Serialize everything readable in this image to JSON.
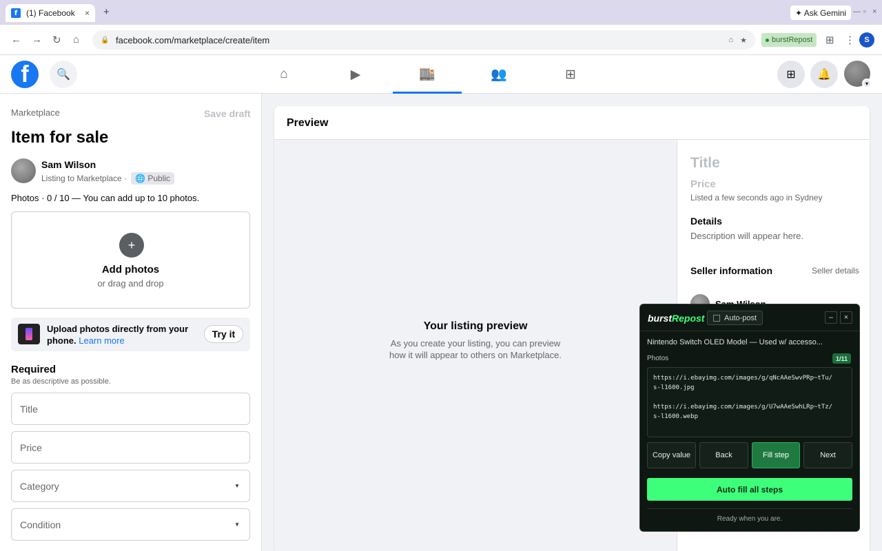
{
  "browser": {
    "tab_title": "(1) Facebook",
    "tab_favicon": "f",
    "tab_close": "×",
    "new_tab": "+",
    "ask_gemini": "✦ Ask Gemini",
    "url": "facebook.com/marketplace/create/item",
    "extension_label": "burstRepost",
    "profile_initial": "S"
  },
  "fb": {
    "logo": "f",
    "nav_active": "marketplace"
  },
  "sidebar": {
    "breadcrumb": "Marketplace",
    "save_draft": "Save draft",
    "title": "Item for sale",
    "seller_name": "Sam Wilson",
    "listing_to": "Listing to Marketplace ·",
    "privacy": "🌐 Public",
    "photos_label": "Photos · 0 / 10 — You can add up to 10 photos.",
    "add_photos": "Add photos",
    "add_photos_sub": "or drag and drop",
    "phone_upload_text": "Upload photos directly from your phone.",
    "learn_more": "Learn more",
    "try_it": "Try it",
    "required": "Required",
    "required_sub": "Be as descriptive as possible.",
    "fields": {
      "title": "Title",
      "price": "Price",
      "category": "Category",
      "condition": "Condition"
    }
  },
  "preview": {
    "header": "Preview",
    "stage_title": "Your listing preview",
    "stage_sub": "As you create your listing, you can preview how it will appear to others on Marketplace.",
    "title_placeholder": "Title",
    "price_placeholder": "Price",
    "listed": "Listed a few seconds ago in Sydney",
    "details": "Details",
    "description": "Description will appear here.",
    "seller_info": "Seller information",
    "seller_details": "Seller details",
    "seller_name": "Sam Wilson"
  },
  "burst": {
    "logo_a": "burst",
    "logo_b": "Repost",
    "auto_post": "Auto-post",
    "minimize": "–",
    "close": "×",
    "item_title": "Nintendo Switch OLED Model — Used w/ accesso...",
    "photos_label": "Photos",
    "photos_count": "1/11",
    "urls": "https://i.ebayimg.com/images/g/qNcAAeSwvPRp~tTu/\ns-l1600.jpg\n\nhttps://i.ebayimg.com/images/g/U7wAAeSwhLRp~tTz/\ns-l1600.webp",
    "buttons": {
      "copy": "Copy value",
      "back": "Back",
      "fill": "Fill step",
      "next": "Next"
    },
    "auto_fill": "Auto fill all steps",
    "status": "Ready when you are."
  }
}
